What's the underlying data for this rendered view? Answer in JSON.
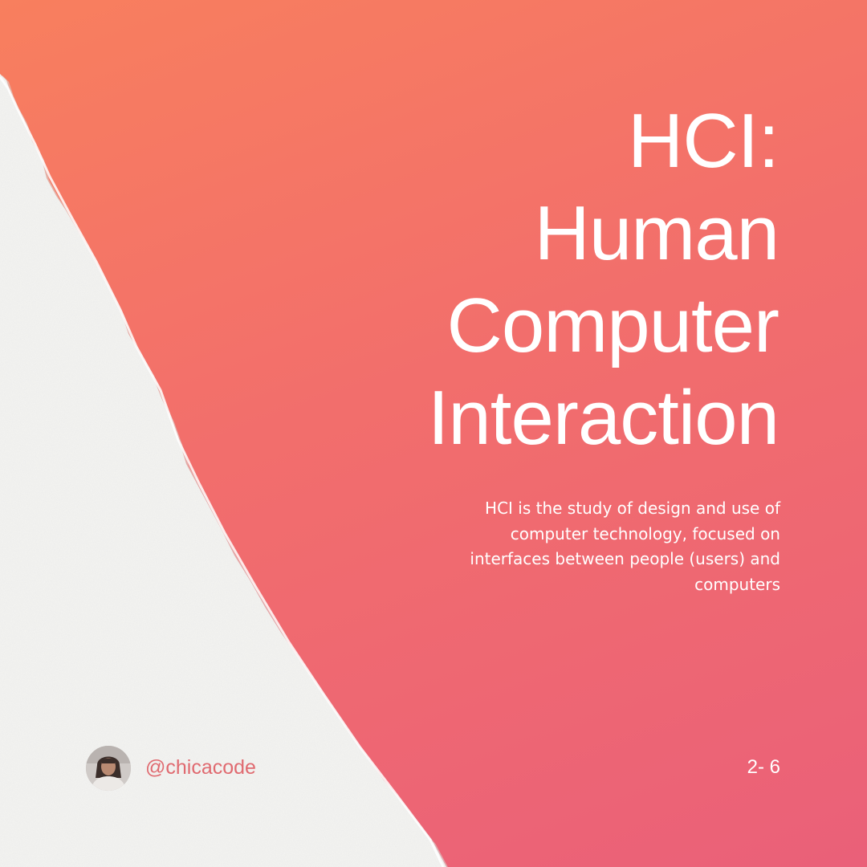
{
  "slide": {
    "title_lines": [
      "HCI:",
      "Human",
      "Computer",
      "Interaction"
    ],
    "description": "HCI is the study of design and use of computer technology, focused on interfaces between people (users) and computers",
    "page_indicator": "2- 6"
  },
  "author": {
    "handle": "@chicacode",
    "avatar_icon": "profile-photo"
  },
  "colors": {
    "gradient_top": "#f87f5e",
    "gradient_bottom": "#ea6079",
    "paper": "#f5f5f3",
    "handle_text": "#e06a70"
  }
}
